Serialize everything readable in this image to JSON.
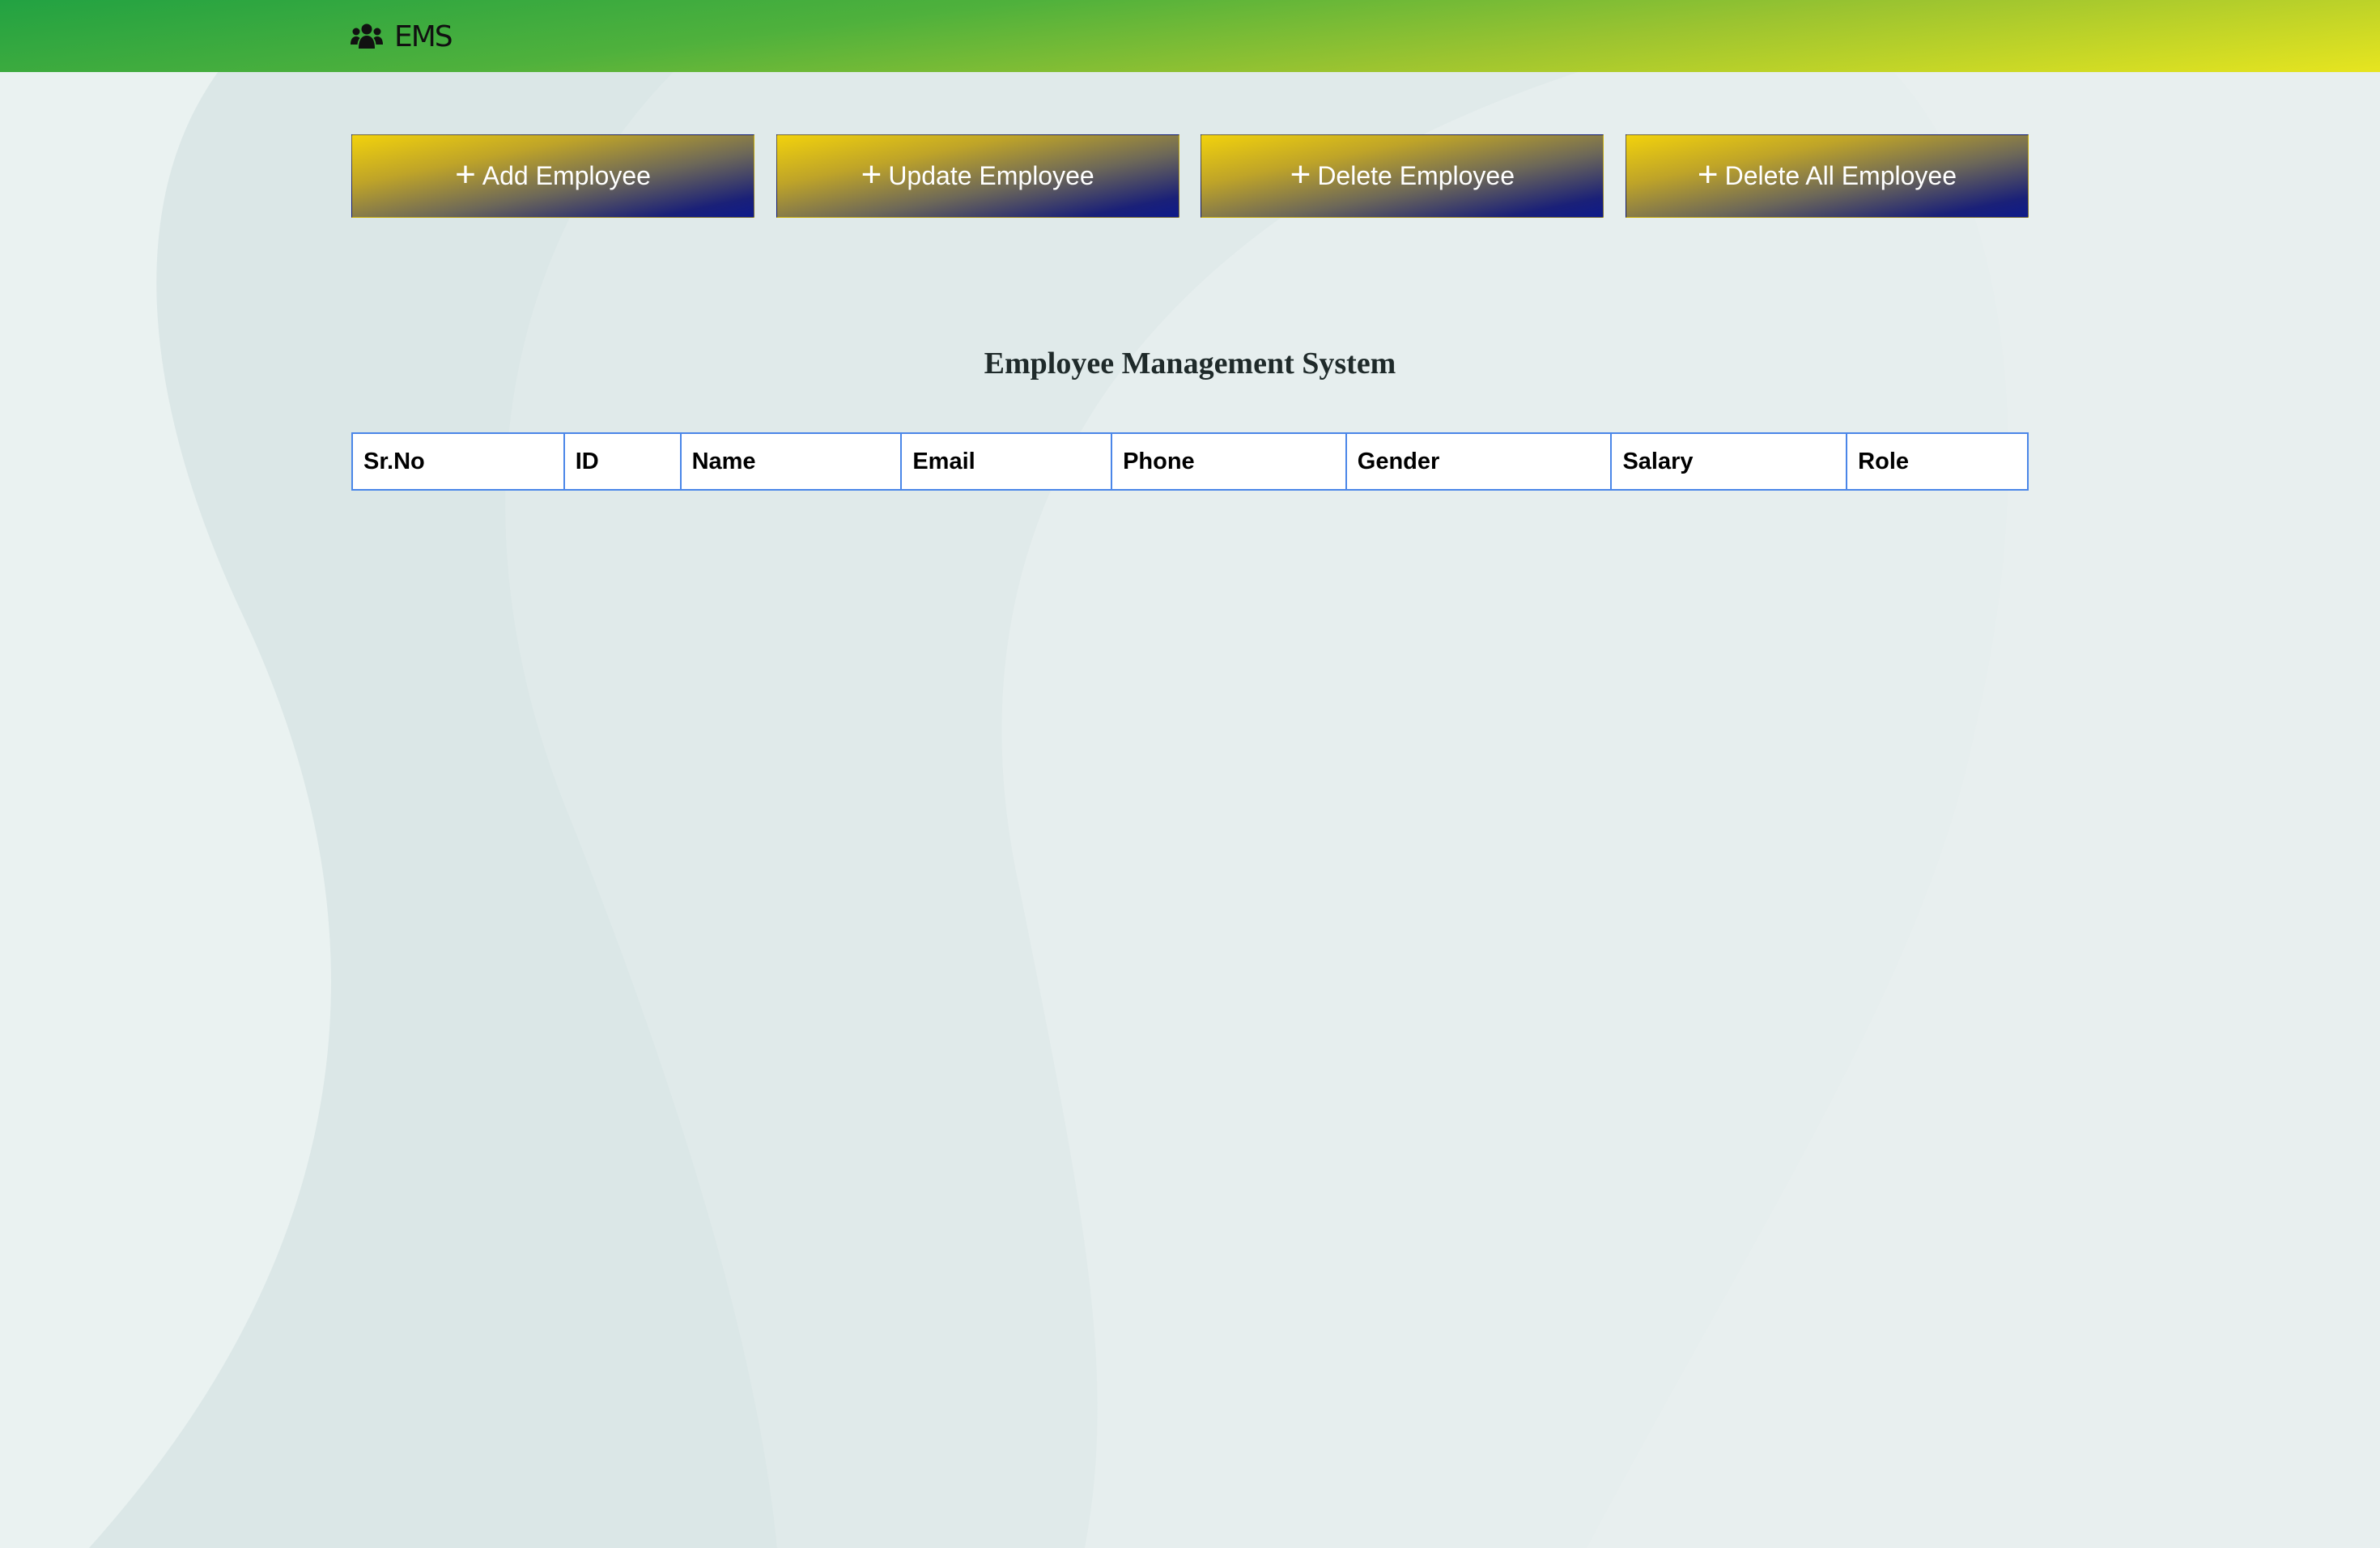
{
  "navbar": {
    "brand_icon": "users-icon",
    "brand_text": "EMS",
    "gradient_colors": [
      "#22a242",
      "#e7e51f"
    ]
  },
  "actions": [
    {
      "label": "Add Employee",
      "icon": "plus-icon"
    },
    {
      "label": "Update Employee",
      "icon": "plus-icon"
    },
    {
      "label": "Delete Employee",
      "icon": "plus-icon"
    },
    {
      "label": "Delete All Employee",
      "icon": "plus-icon"
    }
  ],
  "button_gradient": [
    "#f2d20c",
    "#0e1a8a"
  ],
  "page_title": "Employee Management System",
  "table": {
    "border_color": "#4a86e8",
    "columns": [
      "Sr.No",
      "ID",
      "Name",
      "Email",
      "Phone",
      "Gender",
      "Salary",
      "Role"
    ],
    "rows": []
  }
}
